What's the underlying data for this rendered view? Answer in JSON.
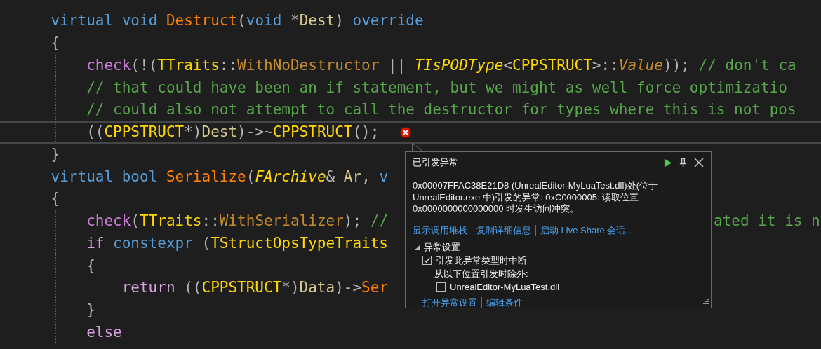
{
  "editor": {
    "lines": [
      {
        "current": false,
        "error": false,
        "tokens": [
          {
            "kind": "kw",
            "text": "virtual void "
          },
          {
            "kind": "fn",
            "text": "Destruct"
          },
          {
            "kind": "punct",
            "text": "("
          },
          {
            "kind": "kw",
            "text": "void"
          },
          {
            "kind": "punct",
            "text": " *"
          },
          {
            "kind": "param",
            "text": "Dest"
          },
          {
            "kind": "punct",
            "text": ") "
          },
          {
            "kind": "kw",
            "text": "override"
          }
        ]
      },
      {
        "current": false,
        "error": false,
        "tokens": [
          {
            "kind": "punct",
            "text": "{"
          }
        ],
        "children": [
          {
            "current": false,
            "error": false,
            "tokens": [
              {
                "kind": "macro",
                "text": "check"
              },
              {
                "kind": "punct",
                "text": "(!("
              },
              {
                "kind": "type",
                "text": "TTraits"
              },
              {
                "kind": "punct",
                "text": "::"
              },
              {
                "kind": "member",
                "text": "WithNoDestructor"
              },
              {
                "kind": "punct",
                "text": " || "
              },
              {
                "kind": "type-italic",
                "text": "TIsPODType"
              },
              {
                "kind": "punct",
                "text": "<"
              },
              {
                "kind": "type",
                "text": "CPPSTRUCT"
              },
              {
                "kind": "punct",
                "text": ">::"
              },
              {
                "kind": "member-italic",
                "text": "Value"
              },
              {
                "kind": "punct",
                "text": ")); "
              },
              {
                "kind": "comment",
                "text": "// don't ca"
              }
            ]
          },
          {
            "current": false,
            "error": false,
            "tokens": [
              {
                "kind": "comment",
                "text": "// that could have been an if statement, but we might as well force optimizatio"
              }
            ]
          },
          {
            "current": false,
            "error": false,
            "tokens": [
              {
                "kind": "comment",
                "text": "// could also not attempt to call the destructor for types where this is not pos"
              }
            ]
          },
          {
            "current": true,
            "error": true,
            "tokens": [
              {
                "kind": "punct",
                "text": "(("
              },
              {
                "kind": "type",
                "text": "CPPSTRUCT"
              },
              {
                "kind": "punct",
                "text": "*)"
              },
              {
                "kind": "param",
                "text": "Dest"
              },
              {
                "kind": "punct",
                "text": ")->~"
              },
              {
                "kind": "type",
                "text": "CPPSTRUCT"
              },
              {
                "kind": "punct",
                "text": "();"
              }
            ]
          }
        ]
      },
      {
        "current": false,
        "error": false,
        "tokens": [
          {
            "kind": "punct",
            "text": "}"
          }
        ]
      },
      {
        "current": false,
        "error": false,
        "tokens": [
          {
            "kind": "kw",
            "text": "virtual bool "
          },
          {
            "kind": "fn",
            "text": "Serialize"
          },
          {
            "kind": "punct",
            "text": "("
          },
          {
            "kind": "type-italic",
            "text": "FArchive"
          },
          {
            "kind": "punct",
            "text": "& "
          },
          {
            "kind": "param",
            "text": "Ar"
          },
          {
            "kind": "punct",
            "text": ", "
          },
          {
            "kind": "kw",
            "text": "v"
          }
        ]
      },
      {
        "current": false,
        "error": false,
        "tokens": [
          {
            "kind": "punct",
            "text": "{"
          }
        ],
        "children": [
          {
            "current": false,
            "error": false,
            "tokens": [
              {
                "kind": "macro",
                "text": "check"
              },
              {
                "kind": "punct",
                "text": "("
              },
              {
                "kind": "type",
                "text": "TTraits"
              },
              {
                "kind": "punct",
                "text": "::"
              },
              {
                "kind": "member",
                "text": "WithSerializer"
              },
              {
                "kind": "punct",
                "text": "); "
              },
              {
                "kind": "comment",
                "text": "//"
              }
            ],
            "right": [
              {
                "kind": "comment",
                "text": "ated it is n"
              }
            ]
          },
          {
            "current": false,
            "error": false,
            "tokens": [
              {
                "kind": "ctrl",
                "text": "if "
              },
              {
                "kind": "kw",
                "text": "constexpr"
              },
              {
                "kind": "punct",
                "text": " ("
              },
              {
                "kind": "type",
                "text": "TStructOpsTypeTraits"
              }
            ]
          },
          {
            "current": false,
            "error": false,
            "tokens": [
              {
                "kind": "punct",
                "text": "{"
              }
            ],
            "children": [
              {
                "current": false,
                "error": false,
                "tokens": [
                  {
                    "kind": "ctrl",
                    "text": "return"
                  },
                  {
                    "kind": "punct",
                    "text": " (("
                  },
                  {
                    "kind": "type",
                    "text": "CPPSTRUCT"
                  },
                  {
                    "kind": "punct",
                    "text": "*)"
                  },
                  {
                    "kind": "param",
                    "text": "Data"
                  },
                  {
                    "kind": "punct",
                    "text": ")->"
                  },
                  {
                    "kind": "fn",
                    "text": "Ser"
                  }
                ]
              }
            ]
          },
          {
            "current": false,
            "error": false,
            "tokens": [
              {
                "kind": "punct",
                "text": "}"
              }
            ]
          },
          {
            "current": false,
            "error": false,
            "tokens": [
              {
                "kind": "ctrl",
                "text": "else"
              }
            ]
          }
        ]
      }
    ]
  },
  "exception_popup": {
    "title": "已引发异常",
    "message": "0x00007FFAC38E21D8 (UnrealEditor-MyLuaTest.dll)处(位于 UnrealEditor.exe 中)引发的异常: 0xC0000005: 读取位置 0x0000000000000000 时发生访问冲突。",
    "links": [
      "显示调用堆栈",
      "复制详细信息",
      "启动 Live Share 会话..."
    ],
    "settings": {
      "title": "异常设置",
      "expanded": true,
      "break_option": {
        "label": "引发此异常类型时中断",
        "checked": true
      },
      "except_label": "从以下位置引发时除外:",
      "modules": [
        {
          "label": "UnrealEditor-MyLuaTest.dll",
          "checked": false
        }
      ]
    },
    "footer_links": [
      "打开异常设置",
      "编辑条件"
    ]
  }
}
